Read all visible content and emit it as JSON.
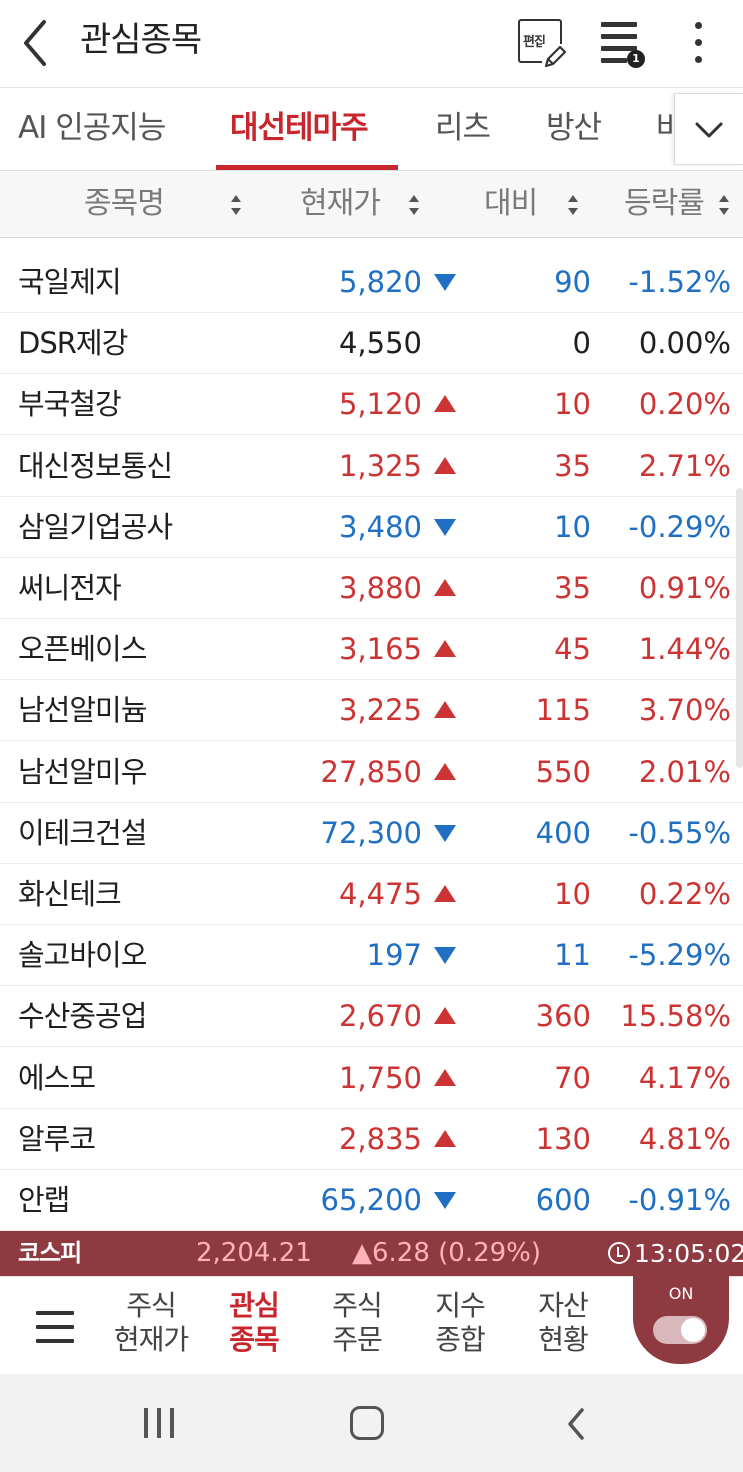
{
  "header": {
    "title": "관심종목",
    "edit_label": "편집",
    "list_badge": "1"
  },
  "tabs": [
    {
      "label": "AI 인공지능",
      "active": false
    },
    {
      "label": "대선테마주",
      "active": true
    },
    {
      "label": "리츠",
      "active": false
    },
    {
      "label": "방산",
      "active": false
    },
    {
      "label": "바",
      "active": false
    }
  ],
  "columns": {
    "name": "종목명",
    "price": "현재가",
    "change": "대비",
    "rate": "등락률"
  },
  "rows": [
    {
      "name": "국일제지",
      "price": "5,820",
      "dir": "down",
      "change": "90",
      "rate": "-1.52%"
    },
    {
      "name": "DSR제강",
      "price": "4,550",
      "dir": "flat",
      "change": "0",
      "rate": "0.00%"
    },
    {
      "name": "부국철강",
      "price": "5,120",
      "dir": "up",
      "change": "10",
      "rate": "0.20%"
    },
    {
      "name": "대신정보통신",
      "price": "1,325",
      "dir": "up",
      "change": "35",
      "rate": "2.71%"
    },
    {
      "name": "삼일기업공사",
      "price": "3,480",
      "dir": "down",
      "change": "10",
      "rate": "-0.29%"
    },
    {
      "name": "써니전자",
      "price": "3,880",
      "dir": "up",
      "change": "35",
      "rate": "0.91%"
    },
    {
      "name": "오픈베이스",
      "price": "3,165",
      "dir": "up",
      "change": "45",
      "rate": "1.44%"
    },
    {
      "name": "남선알미늄",
      "price": "3,225",
      "dir": "up",
      "change": "115",
      "rate": "3.70%"
    },
    {
      "name": "남선알미우",
      "price": "27,850",
      "dir": "up",
      "change": "550",
      "rate": "2.01%"
    },
    {
      "name": "이테크건설",
      "price": "72,300",
      "dir": "down",
      "change": "400",
      "rate": "-0.55%"
    },
    {
      "name": "화신테크",
      "price": "4,475",
      "dir": "up",
      "change": "10",
      "rate": "0.22%"
    },
    {
      "name": "솔고바이오",
      "price": "197",
      "dir": "down",
      "change": "11",
      "rate": "-5.29%"
    },
    {
      "name": "수산중공업",
      "price": "2,670",
      "dir": "up",
      "change": "360",
      "rate": "15.58%"
    },
    {
      "name": "에스모",
      "price": "1,750",
      "dir": "up",
      "change": "70",
      "rate": "4.17%"
    },
    {
      "name": "알루코",
      "price": "2,835",
      "dir": "up",
      "change": "130",
      "rate": "4.81%"
    },
    {
      "name": "안랩",
      "price": "65,200",
      "dir": "down",
      "change": "600",
      "rate": "-0.91%"
    }
  ],
  "ticker": {
    "index_name": "코스피",
    "value": "2,204.21",
    "change": "▲6.28 (0.29%)",
    "time": "13:05:02"
  },
  "bottom_nav": {
    "items": [
      {
        "line1": "주식",
        "line2": "현재가",
        "active": false
      },
      {
        "line1": "관심",
        "line2": "종목",
        "active": true
      },
      {
        "line1": "주식",
        "line2": "주문",
        "active": false
      },
      {
        "line1": "지수",
        "line2": "종합",
        "active": false
      },
      {
        "line1": "자산",
        "line2": "현황",
        "active": false
      }
    ],
    "toggle_label": "ON"
  },
  "colors": {
    "up": "#cc3434",
    "down": "#1f6fc3",
    "accent": "#c8262c",
    "ticker_bg": "#8e3a40"
  }
}
